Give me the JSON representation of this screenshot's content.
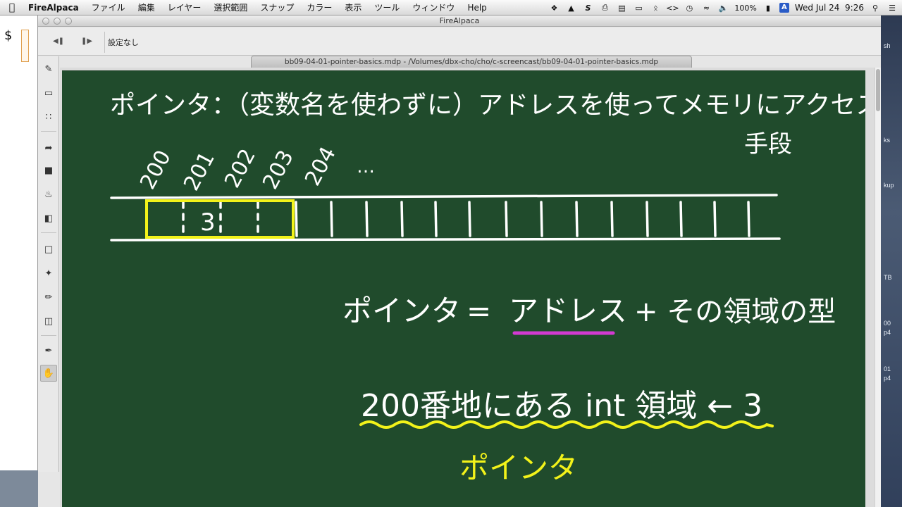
{
  "menubar": {
    "app_name": "FireAlpaca",
    "items": [
      "ファイル",
      "編集",
      "レイヤー",
      "選択範囲",
      "スナップ",
      "カラー",
      "表示",
      "ツール",
      "ウィンドウ",
      "Help"
    ],
    "battery": "100%",
    "input_method": "A",
    "clock": "Wed Jul 24  9:26"
  },
  "terminal": {
    "prompt": "$"
  },
  "window": {
    "title": "FireAlpaca",
    "toolbar_setting": "設定なし",
    "document_tab": "bb09-04-01-pointer-basics.mdp - /Volumes/dbx-cho/cho/c-screencast/bb09-04-01-pointer-basics.mdp"
  },
  "tools": [
    "pen-tool",
    "eraser-tool",
    "dot-tool",
    "move-tool",
    "fill-shape-tool",
    "bucket-tool",
    "gradient-tool",
    "select-tool",
    "magic-wand-tool",
    "select-pen-tool",
    "select-eraser-tool",
    "eyedropper-tool",
    "hand-tool"
  ],
  "board": {
    "heading": "ポインタ：（変数名を使わずに）アドレスを使ってメモリにアクセスする",
    "heading_cont": "手段",
    "addresses": [
      "200",
      "201",
      "202",
      "203",
      "204",
      "…"
    ],
    "cell_value": "3",
    "equation_left": "ポインタ",
    "equation_eq": "=",
    "equation_address": "アドレス",
    "equation_rest": "+ その領域の型",
    "example": "200番地にある int 領域 ← 3",
    "example_label": "ポインタ",
    "colors": {
      "board": "#204b2c",
      "chalk": "#ffffff",
      "highlight": "#f2f21a",
      "underline": "#d23ad2"
    }
  },
  "desktop_labels": [
    "sh",
    "ks",
    "kup",
    "TB",
    "00",
    "p4",
    "01",
    "p4"
  ]
}
